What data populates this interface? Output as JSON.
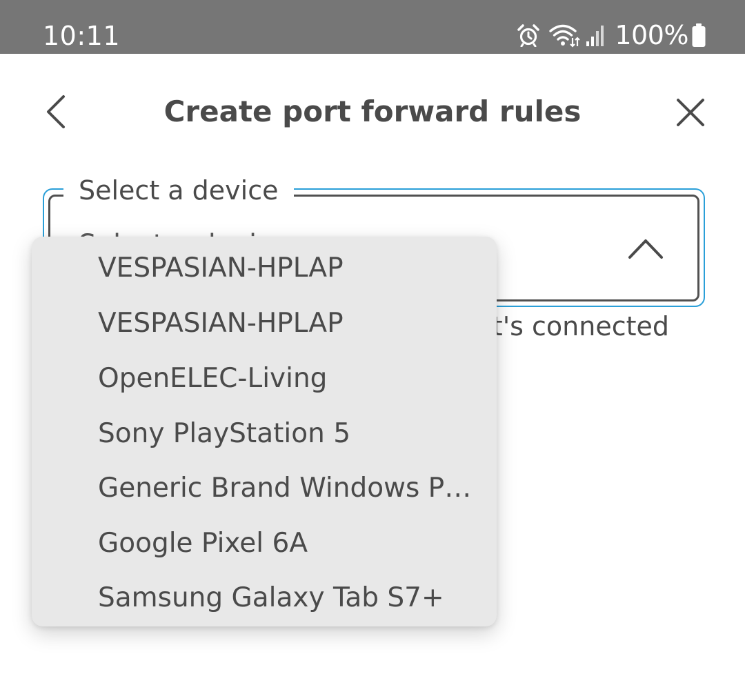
{
  "status_bar": {
    "time": "10:11",
    "battery": "100%",
    "icons": [
      "alarm-icon",
      "wifi-icon",
      "signal-icon",
      "battery-icon"
    ]
  },
  "header": {
    "title": "Create port forward rules",
    "back_icon": "chevron-left-icon",
    "close_icon": "close-icon"
  },
  "form": {
    "select": {
      "label": "Select a device",
      "value": "Select a device",
      "expanded": true
    },
    "helper_text": "t's connected"
  },
  "dropdown": {
    "options": [
      {
        "label": "VESPASIAN-HPLAP"
      },
      {
        "label": "VESPASIAN-HPLAP"
      },
      {
        "label": "OpenELEC-Living"
      },
      {
        "label": "Sony PlayStation 5"
      },
      {
        "label": "Generic Brand Windows PC/..."
      },
      {
        "label": "Google Pixel 6A"
      },
      {
        "label": "Samsung Galaxy Tab S7+"
      }
    ]
  },
  "colors": {
    "status_bar": "#767676",
    "focus_border": "#2a9fd8",
    "text": "#4a4a4a",
    "menu_background": "#e8e8e8"
  }
}
